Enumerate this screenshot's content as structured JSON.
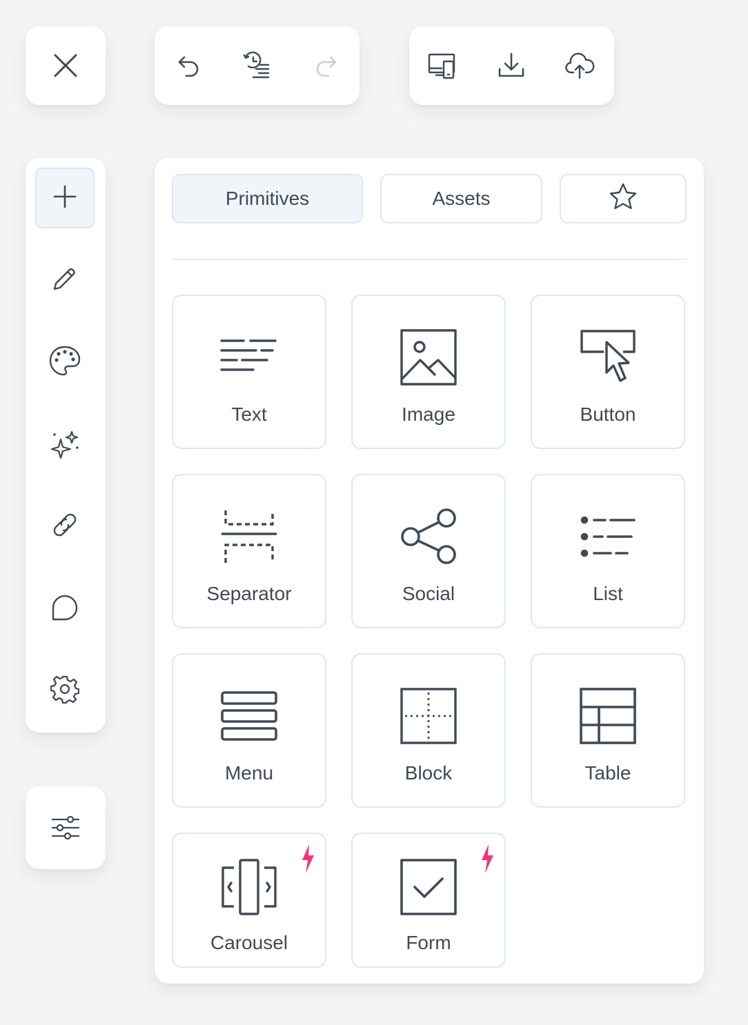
{
  "toolbar": {
    "close_icon": "close-icon",
    "history": [
      "undo-icon",
      "history-icon",
      "redo-icon"
    ],
    "export": [
      "preview-devices-icon",
      "download-icon",
      "upload-cloud-icon"
    ]
  },
  "sidebar": {
    "items": [
      {
        "icon": "plus-icon",
        "active": true
      },
      {
        "icon": "pencil-icon",
        "active": false
      },
      {
        "icon": "palette-icon",
        "active": false
      },
      {
        "icon": "sparkles-icon",
        "active": false
      },
      {
        "icon": "link-icon",
        "active": false
      },
      {
        "icon": "comment-icon",
        "active": false
      },
      {
        "icon": "gear-icon",
        "active": false
      }
    ],
    "bottom_icon": "sliders-icon"
  },
  "panel": {
    "tabs": [
      {
        "label": "Primitives",
        "active": true
      },
      {
        "label": "Assets",
        "active": false
      },
      {
        "label": "",
        "icon": "star-icon",
        "active": false
      }
    ],
    "tiles": [
      {
        "label": "Text",
        "icon": "text-icon",
        "premium": false
      },
      {
        "label": "Image",
        "icon": "image-icon",
        "premium": false
      },
      {
        "label": "Button",
        "icon": "button-icon",
        "premium": false
      },
      {
        "label": "Separator",
        "icon": "separator-icon",
        "premium": false
      },
      {
        "label": "Social",
        "icon": "share-icon",
        "premium": false
      },
      {
        "label": "List",
        "icon": "list-icon",
        "premium": false
      },
      {
        "label": "Menu",
        "icon": "menu-icon",
        "premium": false
      },
      {
        "label": "Block",
        "icon": "block-icon",
        "premium": false
      },
      {
        "label": "Table",
        "icon": "table-icon",
        "premium": false
      },
      {
        "label": "Carousel",
        "icon": "carousel-icon",
        "premium": true
      },
      {
        "label": "Form",
        "icon": "checkbox-icon",
        "premium": true
      }
    ]
  },
  "colors": {
    "background": "#f3f4f5",
    "card": "#ffffff",
    "icon": "#3f4a56",
    "border": "#dbe8f3",
    "active_fill": "#f0f5fa",
    "premium_bolt": "#f2357e"
  }
}
